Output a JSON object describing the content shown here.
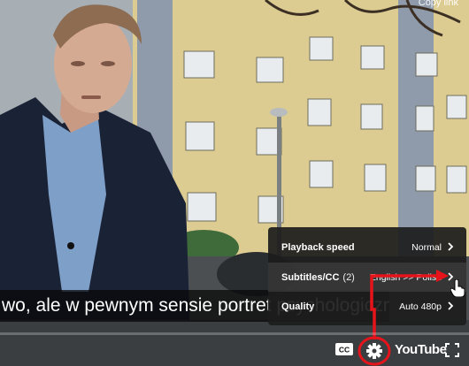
{
  "video": {
    "top_right_label": "Copy link",
    "caption": "wo, ale w pewnym sensie portret psychologiczny."
  },
  "settings_menu": {
    "items": [
      {
        "label": "Playback speed",
        "count": "",
        "value": "Normal"
      },
      {
        "label": "Subtitles/CC",
        "count": "(2)",
        "value": "English >> Polish"
      },
      {
        "label": "Quality",
        "count": "",
        "value": "Auto 480p"
      }
    ]
  },
  "controls": {
    "youtube_logo": "YouTube",
    "cc_label": "CC"
  },
  "colors": {
    "annotation_red": "#e5141b",
    "menu_bg": "#1c1c1c"
  }
}
